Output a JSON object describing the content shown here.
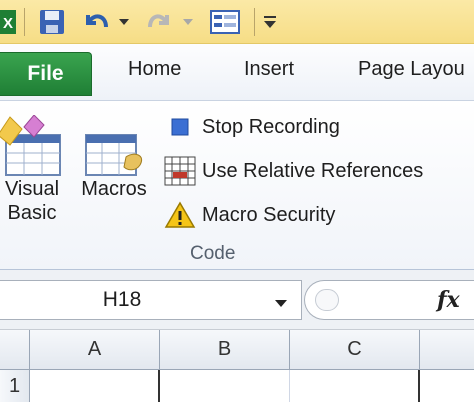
{
  "quick_access": {
    "icons": [
      "excel-logo-icon",
      "save-icon",
      "undo-icon",
      "undo-dropdown-icon",
      "redo-icon",
      "redo-dropdown-icon",
      "form-icon",
      "customize-toolbar-icon"
    ]
  },
  "tabs": [
    {
      "label": "File",
      "active": true
    },
    {
      "label": "Home"
    },
    {
      "label": "Insert"
    },
    {
      "label": "Page Layou"
    }
  ],
  "ribbon": {
    "group_label": "Code",
    "visual_basic": {
      "line1": "Visual",
      "line2": "Basic"
    },
    "macros": {
      "label": "Macros"
    },
    "stop_recording": {
      "label": "Stop Recording"
    },
    "relative_refs": {
      "label": "Use Relative References"
    },
    "macro_security": {
      "label": "Macro Security"
    }
  },
  "formula_bar": {
    "name_box": "H18",
    "fx": "fx",
    "formula": ""
  },
  "grid": {
    "columns": [
      "A",
      "B",
      "C"
    ],
    "rows": [
      "1"
    ]
  },
  "colors": {
    "file_tab": "#2a8f41",
    "title_bar": "#f6dd86",
    "ribbon_bg": "#f1f4f9"
  }
}
